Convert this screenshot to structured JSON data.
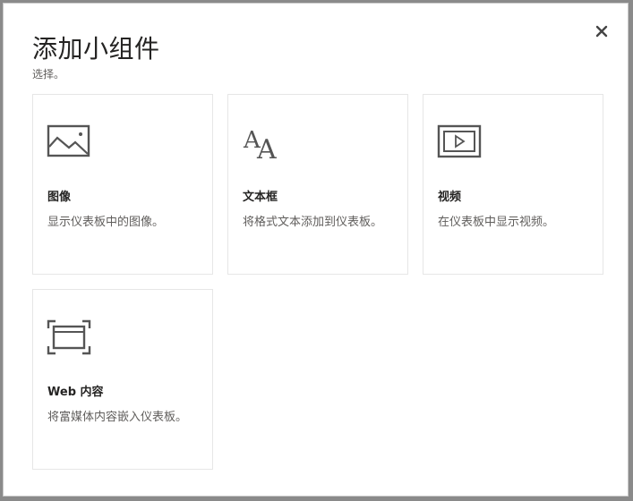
{
  "dialog": {
    "title": "添加小组件",
    "subtitle": "选择。",
    "close_icon": "close-icon"
  },
  "tiles": [
    {
      "title": "图像",
      "description": "显示仪表板中的图像。",
      "icon": "image-icon"
    },
    {
      "title": "文本框",
      "description": "将格式文本添加到仪表板。",
      "icon": "text-icon"
    },
    {
      "title": "视频",
      "description": "在仪表板中显示视频。",
      "icon": "video-icon"
    },
    {
      "title": "Web 内容",
      "description": "将富媒体内容嵌入仪表板。",
      "icon": "web-content-icon"
    }
  ]
}
